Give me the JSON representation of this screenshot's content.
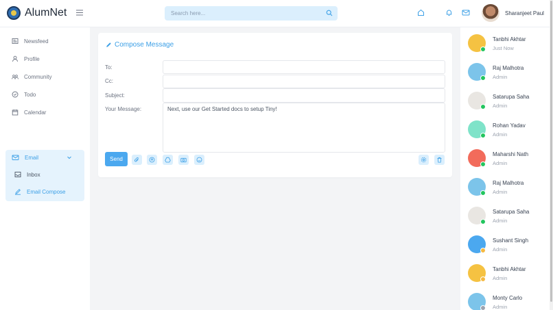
{
  "header": {
    "brand": "AlumNet",
    "search_placeholder": "Search here...",
    "user_name": "Sharanjeet Paul"
  },
  "sidebar": {
    "items": [
      {
        "label": "Newsfeed",
        "icon": "newspaper-icon"
      },
      {
        "label": "Profile",
        "icon": "user-icon"
      },
      {
        "label": "Community",
        "icon": "group-icon"
      },
      {
        "label": "Todo",
        "icon": "check-circle-icon"
      },
      {
        "label": "Calendar",
        "icon": "calendar-icon"
      },
      {
        "label": "Email",
        "icon": "mail-icon"
      },
      {
        "label": "Inbox",
        "icon": "inbox-icon"
      },
      {
        "label": "Email Compose",
        "icon": "pencil-icon"
      }
    ]
  },
  "compose": {
    "title": "Compose Message",
    "to_label": "To:",
    "to_value": "",
    "cc_label": "Cc:",
    "cc_value": "",
    "subject_label": "Subject:",
    "subject_value": "",
    "message_label": "Your Message:",
    "message_value": "Next, use our Get Started docs to setup Tiny!",
    "send_label": "Send"
  },
  "contacts": [
    {
      "name": "Tanbhi Akhtar",
      "sub": "Just Now",
      "avatar_color": "#f5c242",
      "status_color": "#22c55e"
    },
    {
      "name": "Raj Malhotra",
      "sub": "Admin",
      "avatar_color": "#7cc4ea",
      "status_color": "#22c55e"
    },
    {
      "name": "Satarupa Saha",
      "sub": "Admin",
      "avatar_color": "#e9e6e2",
      "status_color": "#22c55e"
    },
    {
      "name": "Rohan Yadav",
      "sub": "Admin",
      "avatar_color": "#7fe3c9",
      "status_color": "#22c55e"
    },
    {
      "name": "Maharshi Nath",
      "sub": "Admin",
      "avatar_color": "#f26b5b",
      "status_color": "#22c55e"
    },
    {
      "name": "Raj Malhotra",
      "sub": "Admin",
      "avatar_color": "#7cc4ea",
      "status_color": "#22c55e"
    },
    {
      "name": "Satarupa Saha",
      "sub": "Admin",
      "avatar_color": "#e9e6e2",
      "status_color": "#22c55e"
    },
    {
      "name": "Sushant Singh",
      "sub": "Admin",
      "avatar_color": "#4ba8ef",
      "status_color": "#f5b942"
    },
    {
      "name": "Tanbhi Akhtar",
      "sub": "Admin",
      "avatar_color": "#f5c242",
      "status_color": "#f5b942"
    },
    {
      "name": "Monty Carlo",
      "sub": "Admin",
      "avatar_color": "#7cc4ea",
      "status_color": "#9ca3af"
    }
  ],
  "colors": {
    "accent": "#3b9fe6",
    "accent_light": "#dbeffd"
  }
}
